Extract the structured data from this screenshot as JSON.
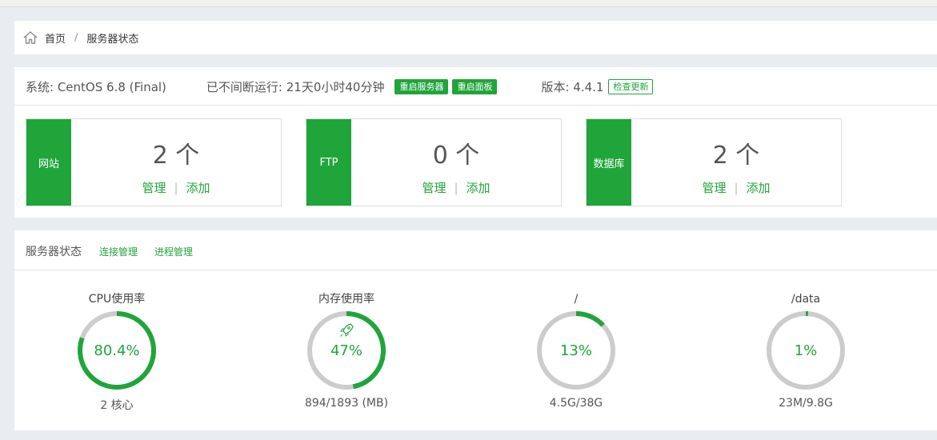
{
  "breadcrumb": {
    "home": "首页",
    "separator": "/",
    "current": "服务器状态"
  },
  "system": {
    "os": "系统: CentOS 6.8 (Final)",
    "uptime": "已不间断运行: 21天0小时40分钟",
    "restart_server": "重启服务器",
    "restart_panel": "重启面板",
    "version": "版本: 4.4.1",
    "check_update": "检查更新"
  },
  "cards": [
    {
      "label": "网站",
      "count": "2 个",
      "manage": "管理",
      "add": "添加"
    },
    {
      "label": "FTP",
      "count": "0 个",
      "manage": "管理",
      "add": "添加"
    },
    {
      "label": "数据库",
      "count": "2 个",
      "manage": "管理",
      "add": "添加"
    }
  ],
  "status": {
    "title": "服务器状态",
    "link_connections": "连接管理",
    "link_processes": "进程管理",
    "gauges": [
      {
        "title": "CPU使用率",
        "value": 80.4,
        "display": "80.4%",
        "bottom": "2 核心",
        "icon": ""
      },
      {
        "title": "内存使用率",
        "value": 47,
        "display": "47%",
        "bottom": "894/1893 (MB)",
        "icon": "rocket-icon"
      },
      {
        "title": "/",
        "value": 13,
        "display": "13%",
        "bottom": "4.5G/38G",
        "icon": ""
      },
      {
        "title": "/data",
        "value": 1,
        "display": "1%",
        "bottom": "23M/9.8G",
        "icon": ""
      }
    ]
  },
  "colors": {
    "accent": "#20a53a",
    "track": "#cccccc"
  }
}
